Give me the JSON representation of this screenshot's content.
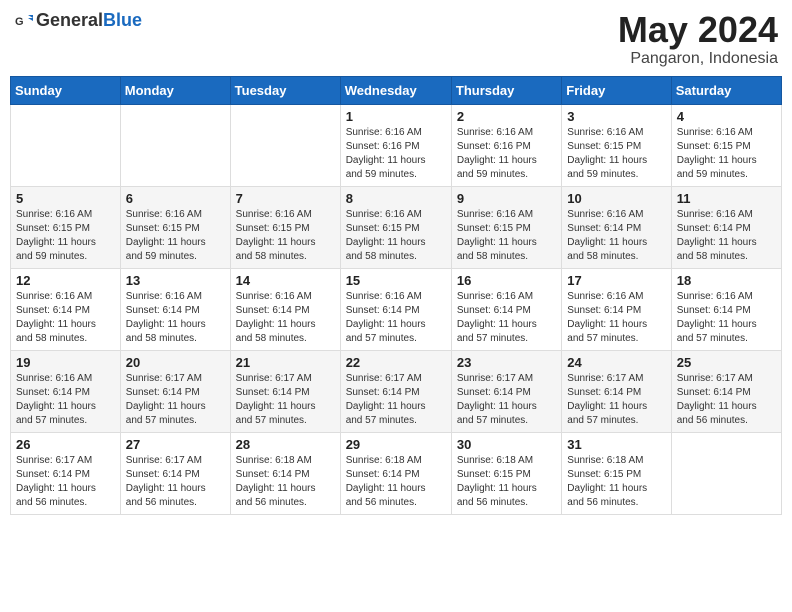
{
  "header": {
    "logo_general": "General",
    "logo_blue": "Blue",
    "month": "May 2024",
    "location": "Pangaron, Indonesia"
  },
  "weekdays": [
    "Sunday",
    "Monday",
    "Tuesday",
    "Wednesday",
    "Thursday",
    "Friday",
    "Saturday"
  ],
  "weeks": [
    [
      {
        "day": "",
        "info": ""
      },
      {
        "day": "",
        "info": ""
      },
      {
        "day": "",
        "info": ""
      },
      {
        "day": "1",
        "info": "Sunrise: 6:16 AM\nSunset: 6:16 PM\nDaylight: 11 hours\nand 59 minutes."
      },
      {
        "day": "2",
        "info": "Sunrise: 6:16 AM\nSunset: 6:16 PM\nDaylight: 11 hours\nand 59 minutes."
      },
      {
        "day": "3",
        "info": "Sunrise: 6:16 AM\nSunset: 6:15 PM\nDaylight: 11 hours\nand 59 minutes."
      },
      {
        "day": "4",
        "info": "Sunrise: 6:16 AM\nSunset: 6:15 PM\nDaylight: 11 hours\nand 59 minutes."
      }
    ],
    [
      {
        "day": "5",
        "info": "Sunrise: 6:16 AM\nSunset: 6:15 PM\nDaylight: 11 hours\nand 59 minutes."
      },
      {
        "day": "6",
        "info": "Sunrise: 6:16 AM\nSunset: 6:15 PM\nDaylight: 11 hours\nand 59 minutes."
      },
      {
        "day": "7",
        "info": "Sunrise: 6:16 AM\nSunset: 6:15 PM\nDaylight: 11 hours\nand 58 minutes."
      },
      {
        "day": "8",
        "info": "Sunrise: 6:16 AM\nSunset: 6:15 PM\nDaylight: 11 hours\nand 58 minutes."
      },
      {
        "day": "9",
        "info": "Sunrise: 6:16 AM\nSunset: 6:15 PM\nDaylight: 11 hours\nand 58 minutes."
      },
      {
        "day": "10",
        "info": "Sunrise: 6:16 AM\nSunset: 6:14 PM\nDaylight: 11 hours\nand 58 minutes."
      },
      {
        "day": "11",
        "info": "Sunrise: 6:16 AM\nSunset: 6:14 PM\nDaylight: 11 hours\nand 58 minutes."
      }
    ],
    [
      {
        "day": "12",
        "info": "Sunrise: 6:16 AM\nSunset: 6:14 PM\nDaylight: 11 hours\nand 58 minutes."
      },
      {
        "day": "13",
        "info": "Sunrise: 6:16 AM\nSunset: 6:14 PM\nDaylight: 11 hours\nand 58 minutes."
      },
      {
        "day": "14",
        "info": "Sunrise: 6:16 AM\nSunset: 6:14 PM\nDaylight: 11 hours\nand 58 minutes."
      },
      {
        "day": "15",
        "info": "Sunrise: 6:16 AM\nSunset: 6:14 PM\nDaylight: 11 hours\nand 57 minutes."
      },
      {
        "day": "16",
        "info": "Sunrise: 6:16 AM\nSunset: 6:14 PM\nDaylight: 11 hours\nand 57 minutes."
      },
      {
        "day": "17",
        "info": "Sunrise: 6:16 AM\nSunset: 6:14 PM\nDaylight: 11 hours\nand 57 minutes."
      },
      {
        "day": "18",
        "info": "Sunrise: 6:16 AM\nSunset: 6:14 PM\nDaylight: 11 hours\nand 57 minutes."
      }
    ],
    [
      {
        "day": "19",
        "info": "Sunrise: 6:16 AM\nSunset: 6:14 PM\nDaylight: 11 hours\nand 57 minutes."
      },
      {
        "day": "20",
        "info": "Sunrise: 6:17 AM\nSunset: 6:14 PM\nDaylight: 11 hours\nand 57 minutes."
      },
      {
        "day": "21",
        "info": "Sunrise: 6:17 AM\nSunset: 6:14 PM\nDaylight: 11 hours\nand 57 minutes."
      },
      {
        "day": "22",
        "info": "Sunrise: 6:17 AM\nSunset: 6:14 PM\nDaylight: 11 hours\nand 57 minutes."
      },
      {
        "day": "23",
        "info": "Sunrise: 6:17 AM\nSunset: 6:14 PM\nDaylight: 11 hours\nand 57 minutes."
      },
      {
        "day": "24",
        "info": "Sunrise: 6:17 AM\nSunset: 6:14 PM\nDaylight: 11 hours\nand 57 minutes."
      },
      {
        "day": "25",
        "info": "Sunrise: 6:17 AM\nSunset: 6:14 PM\nDaylight: 11 hours\nand 56 minutes."
      }
    ],
    [
      {
        "day": "26",
        "info": "Sunrise: 6:17 AM\nSunset: 6:14 PM\nDaylight: 11 hours\nand 56 minutes."
      },
      {
        "day": "27",
        "info": "Sunrise: 6:17 AM\nSunset: 6:14 PM\nDaylight: 11 hours\nand 56 minutes."
      },
      {
        "day": "28",
        "info": "Sunrise: 6:18 AM\nSunset: 6:14 PM\nDaylight: 11 hours\nand 56 minutes."
      },
      {
        "day": "29",
        "info": "Sunrise: 6:18 AM\nSunset: 6:14 PM\nDaylight: 11 hours\nand 56 minutes."
      },
      {
        "day": "30",
        "info": "Sunrise: 6:18 AM\nSunset: 6:15 PM\nDaylight: 11 hours\nand 56 minutes."
      },
      {
        "day": "31",
        "info": "Sunrise: 6:18 AM\nSunset: 6:15 PM\nDaylight: 11 hours\nand 56 minutes."
      },
      {
        "day": "",
        "info": ""
      }
    ]
  ]
}
